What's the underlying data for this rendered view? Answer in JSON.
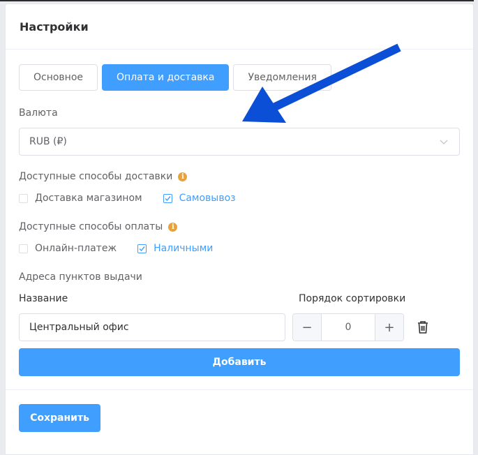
{
  "header": {
    "title": "Настройки"
  },
  "tabs": [
    {
      "label": "Основное",
      "active": false
    },
    {
      "label": "Оплата и доставка",
      "active": true
    },
    {
      "label": "Уведомления",
      "active": false
    }
  ],
  "currency": {
    "label": "Валюта",
    "value": "RUB (₽)"
  },
  "delivery": {
    "label": "Доступные способы доставки",
    "options": [
      {
        "label": "Доставка магазином",
        "checked": false
      },
      {
        "label": "Самовывоз",
        "checked": true
      }
    ]
  },
  "payment": {
    "label": "Доступные способы оплаты",
    "options": [
      {
        "label": "Онлайн-платеж",
        "checked": false
      },
      {
        "label": "Наличными",
        "checked": true
      }
    ]
  },
  "pickup": {
    "label": "Адреса пунктов выдачи",
    "name_header": "Название",
    "sort_header": "Порядок сортировки",
    "name_value": "Центральный офис",
    "sort_value": "0",
    "add_label": "Добавить"
  },
  "actions": {
    "save_label": "Сохранить"
  },
  "icons": {
    "info": "info-icon",
    "chevron": "chevron-down-icon",
    "minus": "minus-icon",
    "plus": "plus-icon",
    "trash": "trash-icon",
    "annotation": "arrow-annotation"
  },
  "colors": {
    "primary": "#409eff",
    "info": "#e6a23c",
    "annotation_arrow": "#0a4fd6"
  }
}
